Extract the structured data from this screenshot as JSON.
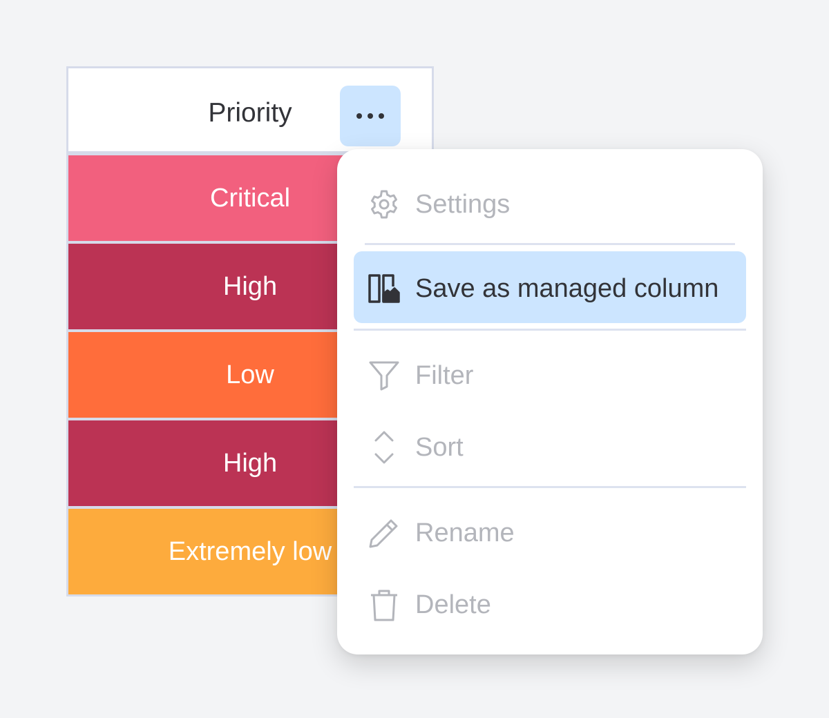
{
  "column": {
    "header": "Priority",
    "more_icon": "more-horizontal-icon",
    "rows": [
      {
        "label": "Critical",
        "color": "#f2607e"
      },
      {
        "label": "High",
        "color": "#bb3354"
      },
      {
        "label": "Low",
        "color": "#ff6d3b"
      },
      {
        "label": "High",
        "color": "#bb3354"
      },
      {
        "label": "Extremely low",
        "color": "#fdab3d"
      }
    ]
  },
  "menu": {
    "settings": {
      "label": "Settings",
      "icon": "gear-icon"
    },
    "save_managed": {
      "label": "Save as managed column",
      "icon": "managed-column-icon",
      "active": true
    },
    "filter": {
      "label": "Filter",
      "icon": "filter-icon"
    },
    "sort": {
      "label": "Sort",
      "icon": "sort-icon"
    },
    "rename": {
      "label": "Rename",
      "icon": "pencil-icon"
    },
    "delete": {
      "label": "Delete",
      "icon": "trash-icon"
    }
  },
  "colors": {
    "active_highlight": "#cce5ff",
    "disabled_text": "#b3b5bb",
    "primary_text": "#323338"
  }
}
